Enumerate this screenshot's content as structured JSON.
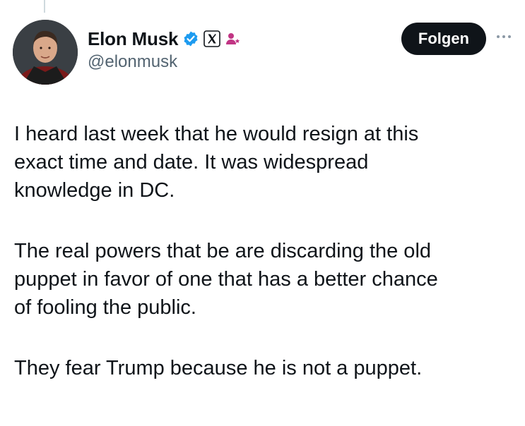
{
  "author": {
    "display_name": "Elon Musk",
    "handle": "@elonmusk"
  },
  "badges": {
    "verified": "verified-check-icon",
    "affiliate": "x-logo-icon",
    "role": "person-badge-icon"
  },
  "colors": {
    "verified": "#1d9bf0",
    "role_badge": "#c13584",
    "text": "#0f1419",
    "secondary": "#536471",
    "button_bg": "#0f1419",
    "button_text": "#ffffff"
  },
  "actions": {
    "follow_label": "Folgen",
    "more_icon": "more-horizontal-icon"
  },
  "tweet": {
    "paragraphs": [
      "I heard last week that he would resign at this\nexact time and date. It was widespread\nknowledge in DC.",
      "The real powers that be are discarding the old\npuppet in favor of one that has a better chance\nof fooling the public.",
      "They fear Trump because he is not a puppet."
    ]
  }
}
